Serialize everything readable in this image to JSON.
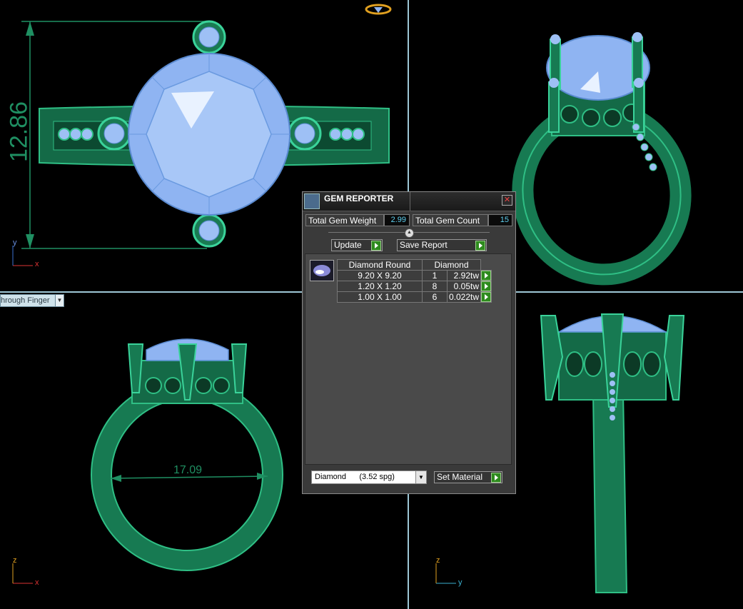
{
  "dimensions": {
    "height": "12.86",
    "inner_diameter": "17.09"
  },
  "axis_labels": {
    "top_left": {
      "v": "y",
      "h": "x"
    },
    "bottom_left": {
      "v": "z",
      "h": "x"
    },
    "bottom_right": {
      "v": "z",
      "h": "y"
    }
  },
  "view_dropdown": {
    "value": "hrough Finger"
  },
  "colors": {
    "metal": "#1f8f62",
    "gem": "#8fb4f2",
    "viewport_border": "#9ec7d6",
    "value_text": "#5fd0f0",
    "button_green": "#2e8b1e"
  },
  "gem_reporter": {
    "title": "GEM REPORTER",
    "total_weight_label": "Total Gem Weight",
    "total_weight_value": "2.99",
    "total_count_label": "Total Gem Count",
    "total_count_value": "15",
    "update_label": "Update",
    "save_report_label": "Save Report",
    "table": {
      "header_shape": "Diamond Round",
      "header_material": "Diamond",
      "rows": [
        {
          "size": "9.20 X 9.20",
          "count": "1",
          "weight": "2.92tw"
        },
        {
          "size": "1.20 X 1.20",
          "count": "8",
          "weight": "0.05tw"
        },
        {
          "size": "1.00 X 1.00",
          "count": "6",
          "weight": "0.022tw"
        }
      ]
    },
    "material_select": "Diamond      (3.52 spg)",
    "set_material_label": "Set Material"
  }
}
